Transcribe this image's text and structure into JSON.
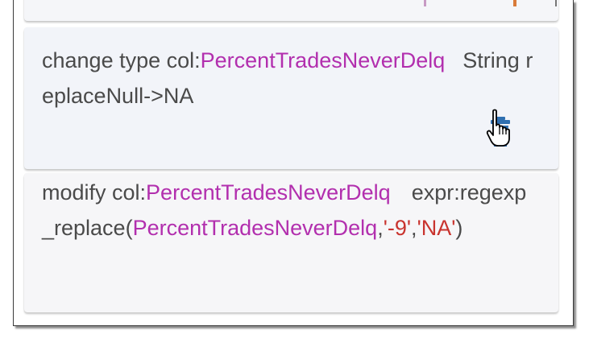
{
  "steps": [
    {
      "action": "change type col:",
      "column": "PercentTradesNeverDelq",
      "rest": "String replaceNull->NA"
    },
    {
      "action": "modify col:",
      "column": "PercentTradesNeverDelq",
      "expr_prefix": "expr:regexp_replace(",
      "expr_column": "PercentTradesNeverDelq",
      "comma1": ",",
      "arg1": "'-9'",
      "comma2": ",",
      "arg2": "'NA'",
      "expr_suffix": ")"
    }
  ],
  "icons": {
    "delete": "trash-icon",
    "pointer": "hand-pointer-cursor"
  },
  "colors": {
    "column_highlight": "#b22fae",
    "string_literal": "#c9342f",
    "trash": "#2f6fb0"
  }
}
